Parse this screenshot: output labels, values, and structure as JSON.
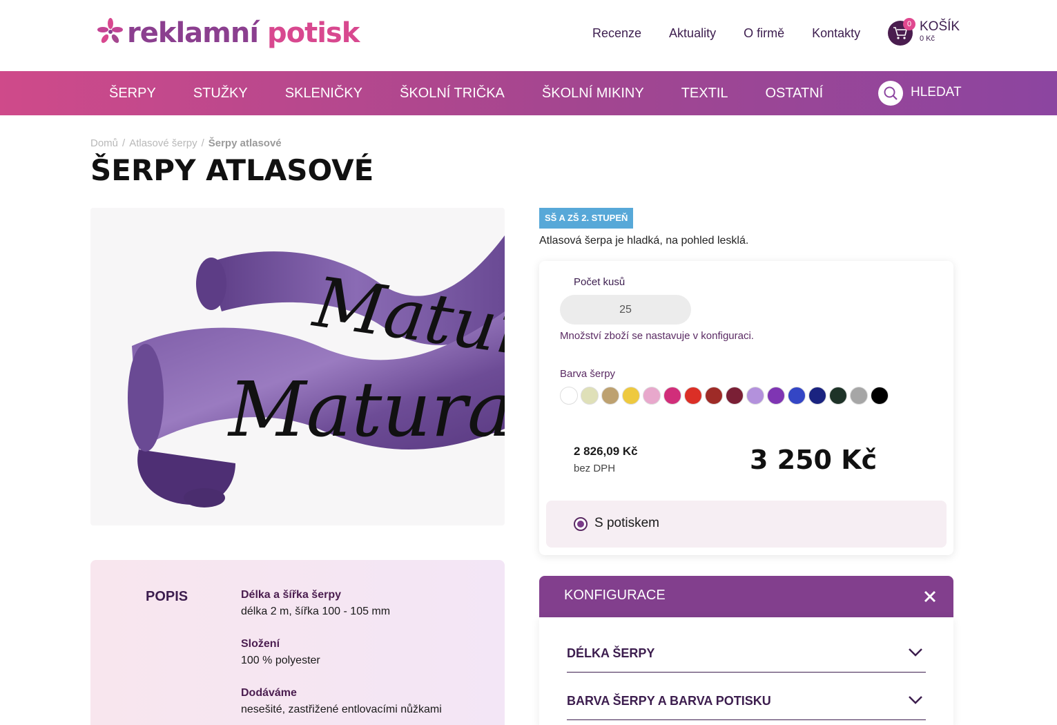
{
  "brand": {
    "part1": "reklamní",
    "part2": "potisk"
  },
  "topnav": [
    "Recenze",
    "Aktuality",
    "O firmě",
    "Kontakty"
  ],
  "cart": {
    "label": "KOŠÍK",
    "count": "0",
    "sum": "0 Kč"
  },
  "mainnav": [
    "ŠERPY",
    "STUŽKY",
    "SKLENIČKY",
    "ŠKOLNÍ TRIČKA",
    "ŠKOLNÍ MIKINY",
    "TEXTIL",
    "OSTATNÍ"
  ],
  "search": {
    "label": "HLEDAT"
  },
  "breadcrumb": [
    "Domů",
    "Atlasové šerpy",
    "Šerpy atlasové"
  ],
  "product": {
    "title": "ŠERPY ATLASOVÉ",
    "tag": "SŠ A ZŠ 2. STUPEŇ",
    "description": "Atlasová šerpa je hladká, na pohled lesklá.",
    "image_text": "Matura"
  },
  "config": {
    "qty_label": "Počet kusů",
    "qty_value": "25",
    "qty_note": "Množství zboží se nastavuje v konfiguraci.",
    "color_label": "Barva šerpy",
    "swatches": [
      "#ffffff",
      "#dfe0b8",
      "#bda170",
      "#eec93f",
      "#e8a8cc",
      "#d12e7a",
      "#db2f26",
      "#9e2b27",
      "#7a1f35",
      "#b391dc",
      "#7f35b3",
      "#3446c5",
      "#1a2380",
      "#1e3328",
      "#a6a6a6",
      "#000000"
    ],
    "price_net": "2 826,09 Kč",
    "price_net_label": "bez DPH",
    "price_gross": "3 250 Kč",
    "print_option": "S potiskem"
  },
  "popis": {
    "heading": "POPIS",
    "specs": [
      {
        "k": "Délka a šířka šerpy",
        "v": "délka 2 m, šířka 100 - 105 mm"
      },
      {
        "k": "Složení",
        "v": "100 % polyester"
      },
      {
        "k": "Dodáváme",
        "v": "nesešité, zastřižené entlovacími nůžkami"
      }
    ]
  },
  "konfigurace": {
    "title": "KONFIGURACE",
    "sections": [
      "DÉLKA ŠERPY",
      "BARVA ŠERPY A BARVA POTISKU"
    ]
  },
  "colors": {
    "accent": "#823f8d",
    "pink": "#d8488f",
    "tag": "#57a8d8"
  }
}
